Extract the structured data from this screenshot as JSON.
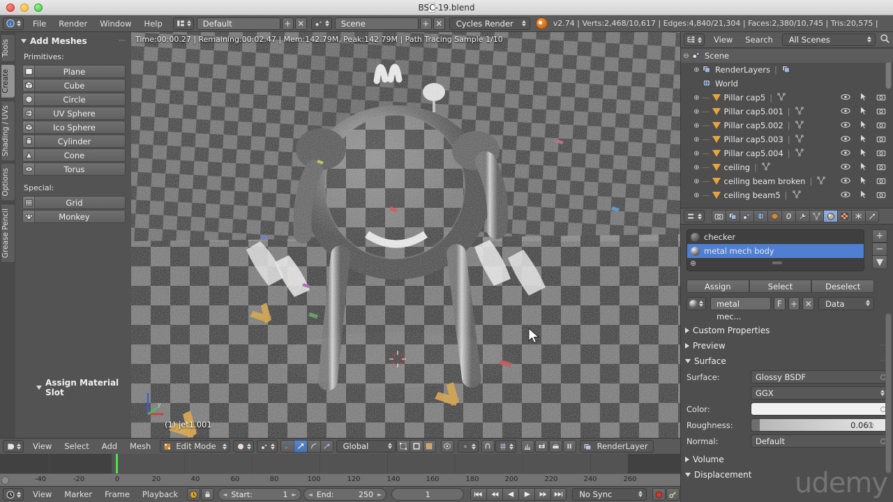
{
  "window": {
    "title": "BSC-19.blend",
    "controls": [
      "close",
      "minimize",
      "zoom"
    ]
  },
  "topbar": {
    "menus": [
      "File",
      "Render",
      "Window",
      "Help"
    ],
    "screen_layout": "Default",
    "scene_name": "Scene",
    "engine": "Cycles Render",
    "stats": "v2.74 | Verts:2,468/10,617 | Edges:4,840/21,304 | Faces:2,380/10,745 | Tris:20,575 |",
    "add_label": "+",
    "close_label": "✕"
  },
  "toolshelf": {
    "tabs": [
      {
        "label": "Tools",
        "active": false
      },
      {
        "label": "Create",
        "active": true
      },
      {
        "label": "Shading / UVs",
        "active": false
      },
      {
        "label": "Options",
        "active": false
      },
      {
        "label": "Grease Pencil",
        "active": false
      }
    ],
    "panel_title": "Add Meshes",
    "primitives_label": "Primitives:",
    "primitives": [
      "Plane",
      "Cube",
      "Circle",
      "UV Sphere",
      "Ico Sphere",
      "Cylinder",
      "Cone",
      "Torus"
    ],
    "special_label": "Special:",
    "special": [
      "Grid",
      "Monkey"
    ],
    "assign_panel_title": "Assign Material Slot"
  },
  "viewport": {
    "render_info": "Time:00:00.27 | Remaining:00:02.47 | Mem:142.79M, Peak:142.79M | Path Tracing Sample 1/10",
    "object_label": "(1) jet1.001",
    "axis_labels": {
      "x": "x",
      "y": "y",
      "z": "z"
    },
    "header": {
      "menus": [
        "View",
        "Select",
        "Add",
        "Mesh"
      ],
      "mode": "Edit Mode",
      "transform_orientation": "Global",
      "render_layer": "RenderLayer"
    }
  },
  "timeline": {
    "ruler_ticks": [
      -40,
      -20,
      0,
      20,
      40,
      60,
      80,
      100,
      120,
      140,
      160,
      180,
      200,
      220,
      240,
      260
    ],
    "current_frame": 1,
    "menus": [
      "View",
      "Marker",
      "Frame",
      "Playback"
    ],
    "start_label": "Start:",
    "start_value": "1",
    "end_label": "End:",
    "end_value": "250",
    "frame_value": "1",
    "sync_mode": "No Sync"
  },
  "outliner": {
    "menus": [
      "View",
      "Search"
    ],
    "display_mode": "All Scenes",
    "rows": [
      {
        "label": "Scene",
        "indent": 0,
        "icon": "scene-icon",
        "expandable": true,
        "expanded": true,
        "selected": true,
        "show_toggles": false
      },
      {
        "label": "RenderLayers",
        "indent": 1,
        "icon": "renderlayers-icon",
        "expandable": true,
        "expanded": false,
        "selected": false,
        "show_toggles": false
      },
      {
        "label": "World",
        "indent": 1,
        "icon": "world-icon",
        "expandable": false,
        "expanded": false,
        "selected": false,
        "show_toggles": false
      },
      {
        "label": "Pillar cap5",
        "indent": 1,
        "icon": "mesh-icon",
        "expandable": true,
        "expanded": false,
        "selected": false,
        "show_toggles": true
      },
      {
        "label": "Pillar cap5.001",
        "indent": 1,
        "icon": "mesh-icon",
        "expandable": true,
        "expanded": false,
        "selected": false,
        "show_toggles": true
      },
      {
        "label": "Pillar cap5.002",
        "indent": 1,
        "icon": "mesh-icon",
        "expandable": true,
        "expanded": false,
        "selected": false,
        "show_toggles": true
      },
      {
        "label": "Pillar cap5.003",
        "indent": 1,
        "icon": "mesh-icon",
        "expandable": true,
        "expanded": false,
        "selected": false,
        "show_toggles": true
      },
      {
        "label": "Pillar cap5.004",
        "indent": 1,
        "icon": "mesh-icon",
        "expandable": true,
        "expanded": false,
        "selected": false,
        "show_toggles": true
      },
      {
        "label": "ceiling",
        "indent": 1,
        "icon": "mesh-icon",
        "expandable": true,
        "expanded": false,
        "selected": false,
        "show_toggles": true
      },
      {
        "label": "ceiling beam broken",
        "indent": 1,
        "icon": "mesh-icon",
        "expandable": true,
        "expanded": false,
        "selected": false,
        "show_toggles": true
      },
      {
        "label": "ceiling beam5",
        "indent": 1,
        "icon": "mesh-icon",
        "expandable": true,
        "expanded": false,
        "selected": false,
        "show_toggles": true
      }
    ]
  },
  "properties": {
    "tabs": [
      {
        "name": "render",
        "active": false
      },
      {
        "name": "render-layers",
        "active": false
      },
      {
        "name": "scene",
        "active": false
      },
      {
        "name": "world",
        "active": false
      },
      {
        "name": "object",
        "active": false
      },
      {
        "name": "constraints",
        "active": false
      },
      {
        "name": "modifiers",
        "active": false
      },
      {
        "name": "object-data",
        "active": false
      },
      {
        "name": "material",
        "active": true
      },
      {
        "name": "texture",
        "active": false
      },
      {
        "name": "particles",
        "active": false
      },
      {
        "name": "physics",
        "active": false
      }
    ],
    "material_slots": [
      {
        "label": "checker",
        "selected": false
      },
      {
        "label": "metal mech body",
        "selected": true
      }
    ],
    "slot_buttons": [
      "Assign",
      "Select",
      "Deselect"
    ],
    "material_name": "metal mec...",
    "fake_user_label": "F",
    "add_label": "+",
    "unlink_label": "✕",
    "data_link": "Data",
    "sections": {
      "custom_properties": "Custom Properties",
      "preview": "Preview",
      "surface": "Surface",
      "volume": "Volume",
      "displacement": "Displacement"
    },
    "surface": {
      "surface_label": "Surface:",
      "surface_value": "Glossy BSDF",
      "distribution_value": "GGX",
      "color_label": "Color:",
      "color_value": "#F2F2F2",
      "roughness_label": "Roughness:",
      "roughness_value": "0.061",
      "normal_label": "Normal:",
      "normal_value": "Default"
    }
  },
  "watermark": {
    "brand": "udemy"
  },
  "colors": {
    "accent_blue": "#4f7fd1",
    "header_gray": "#5a5a5a",
    "panel_gray": "#4e4e4e",
    "mesh_orange": "#e8a33d",
    "playhead_green": "#4ce44c"
  }
}
